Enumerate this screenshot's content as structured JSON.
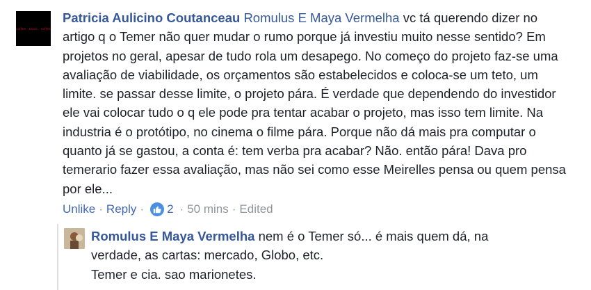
{
  "comment": {
    "author": "Patricia Aulicino Coutanceau",
    "mention": "Romulus E Maya Vermelha",
    "text": " vc tá querendo dizer no artigo q o Temer não quer mudar o rumo porque já investiu muito nesse sentido? Em projetos no geral, apesar de tudo rola um desapego. No começo do projeto faz-se uma avaliação de viabilidade, os orçamentos são estabelecidos e coloca-se um teto, um limite. se passar desse limite, o projeto pára. É verdade que dependendo do investidor ele vai colocar tudo o q ele pode pra tentar acabar o projeto, mas isso tem limite. Na industria é o protótipo, no cinema o filme pára. Porque não dá mais pra computar o quanto já se gastou, a conta é: tem verba pra acabar? Não. então pára! Dava pro temerario fazer essa avaliação, mas não sei como esse Meirelles pensa ou quem pensa por ele...",
    "avatar_text": "coffee · black · coffee",
    "actions": {
      "unlike": "Unlike",
      "reply": "Reply",
      "like_count": "2",
      "time": "50 mins",
      "edited": "Edited",
      "sep": "·"
    }
  },
  "reply": {
    "author": "Romulus E Maya Vermelha",
    "text": " nem é o Temer só... é mais quem dá, na verdade, as cartas: mercado, Globo, etc.",
    "text2": "Temer e cia. sao marionetes."
  }
}
